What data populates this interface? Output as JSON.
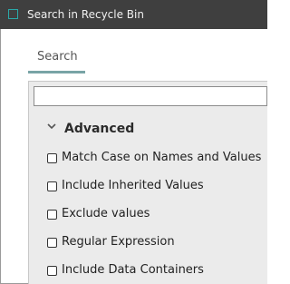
{
  "window": {
    "title": "Search in Recycle Bin",
    "accent_color": "#2aa9a9",
    "titlebar_color": "#3f3f3f"
  },
  "tabs": [
    {
      "label": "Search",
      "active": true
    }
  ],
  "search": {
    "value": "",
    "placeholder": ""
  },
  "advanced": {
    "title": "Advanced",
    "expanded": true,
    "icon": "chevron-down-icon",
    "options": [
      {
        "label": "Match Case on Names and Values",
        "checked": false
      },
      {
        "label": "Include Inherited Values",
        "checked": false
      },
      {
        "label": "Exclude values",
        "checked": false
      },
      {
        "label": "Regular Expression",
        "checked": false
      },
      {
        "label": "Include Data Containers",
        "checked": false
      }
    ]
  }
}
